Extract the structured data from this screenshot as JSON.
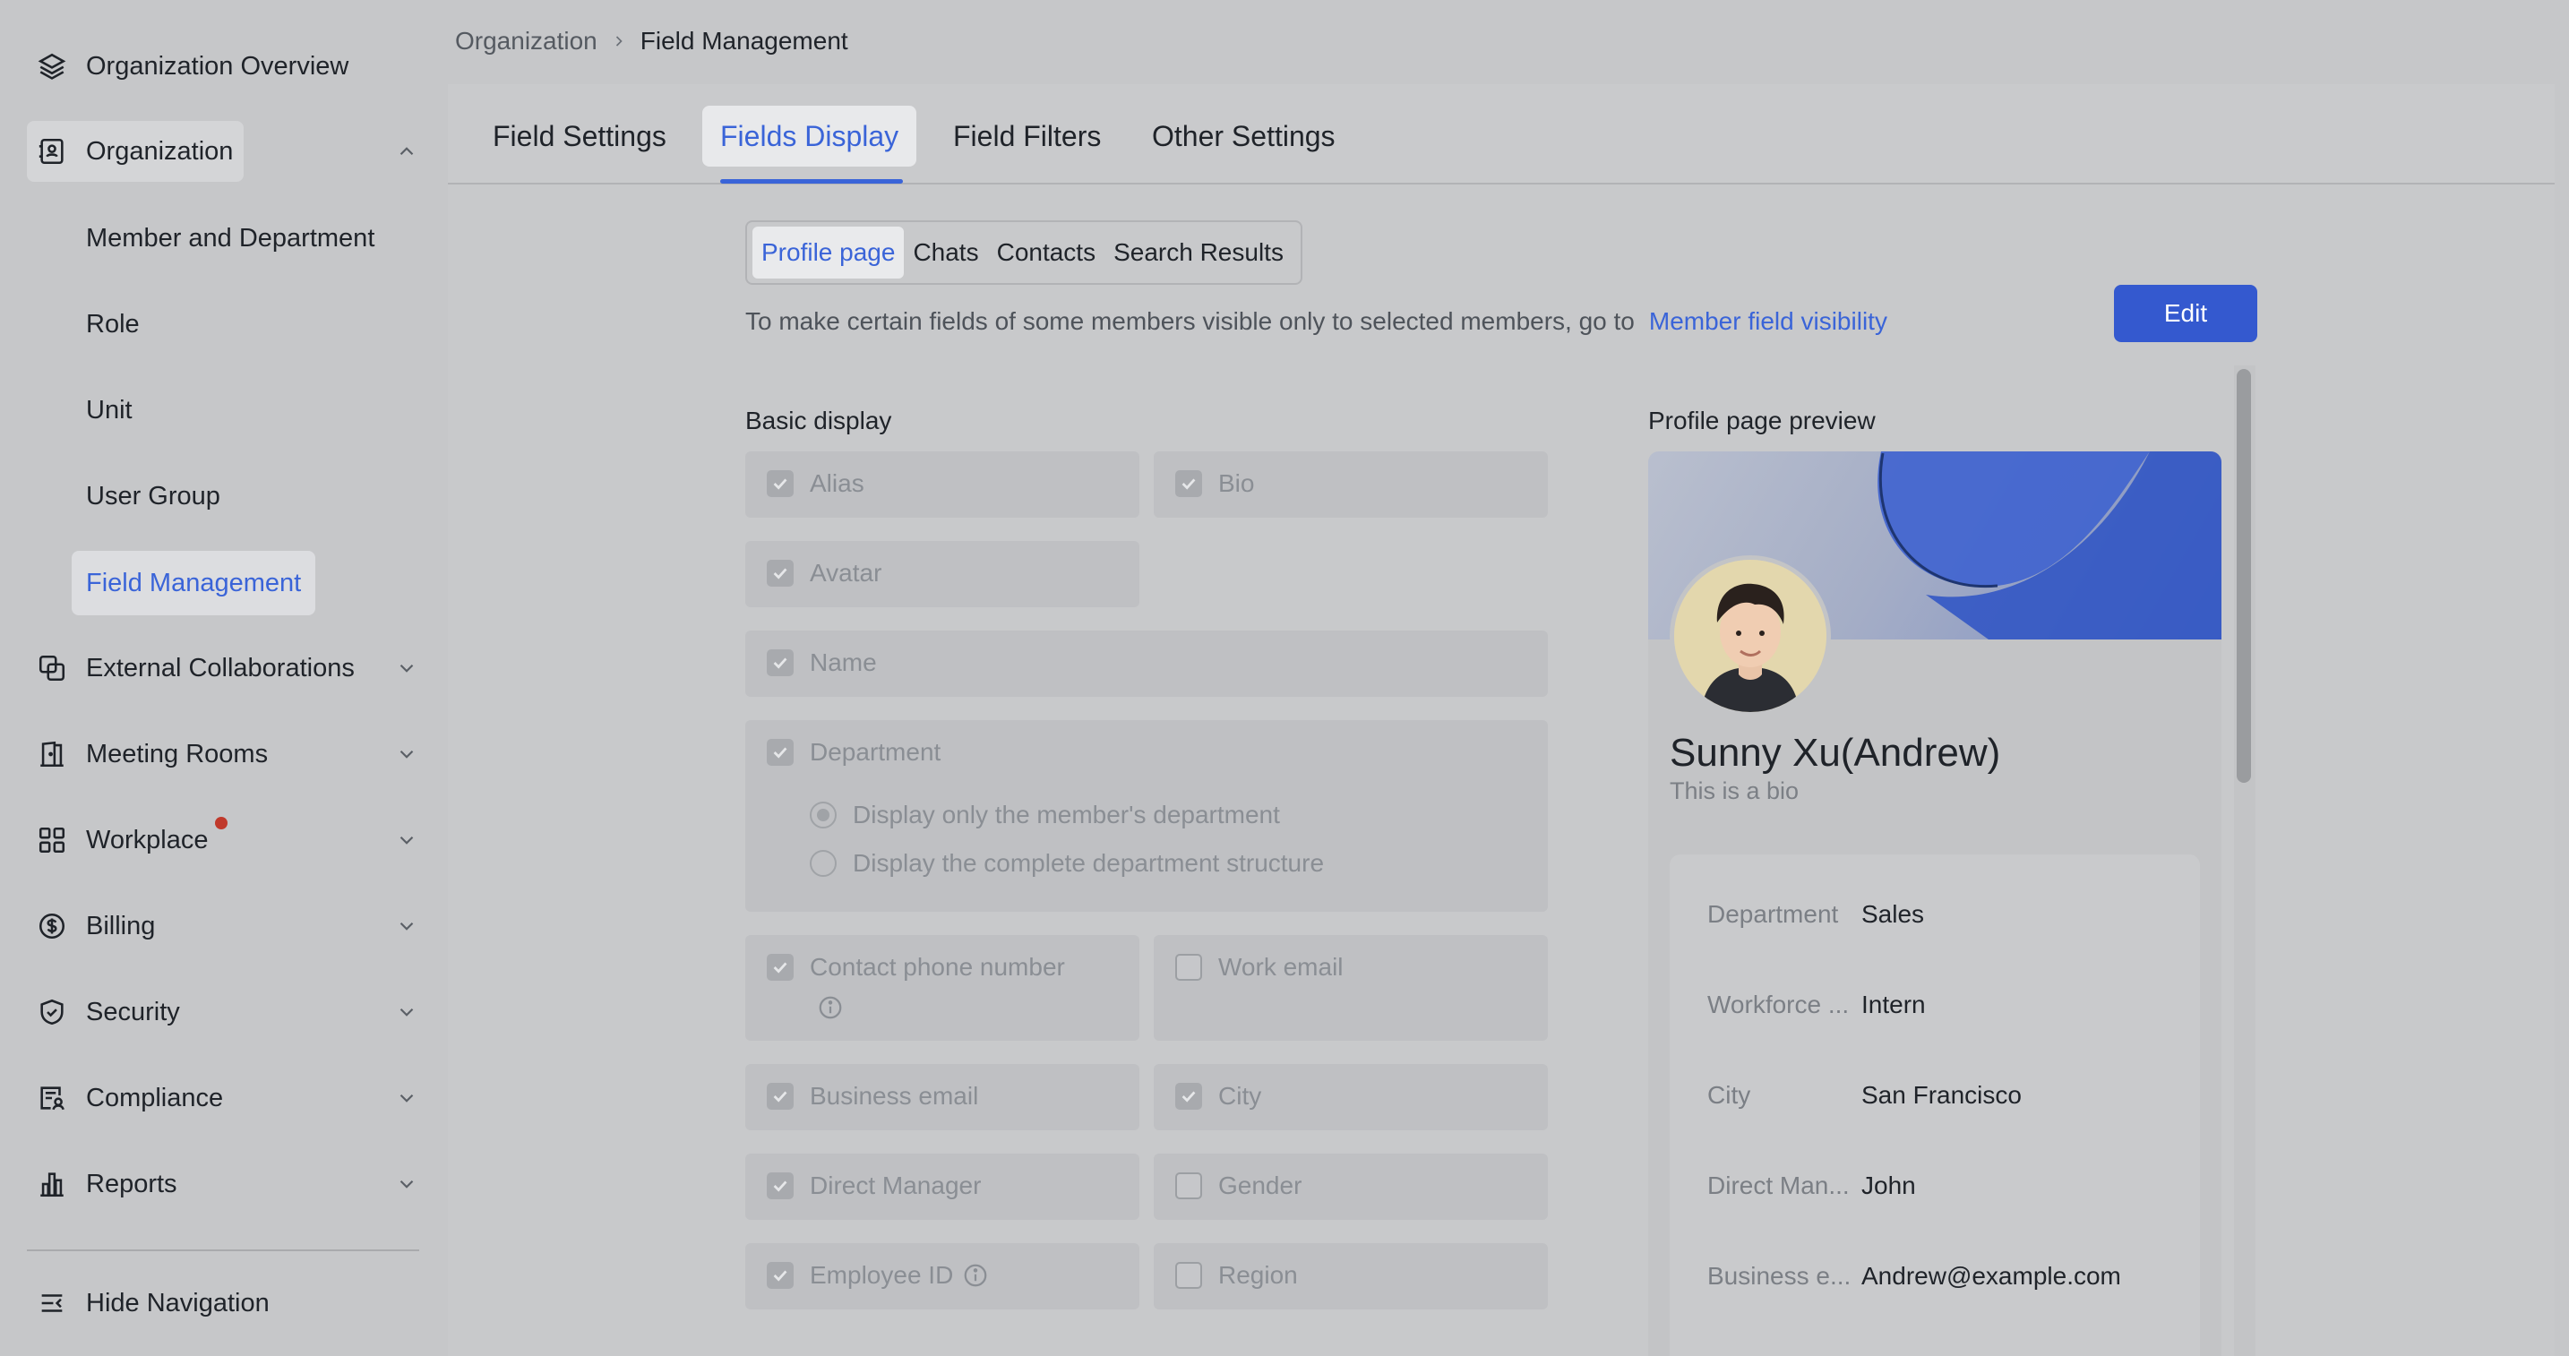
{
  "breadcrumb": {
    "parent": "Organization",
    "current": "Field Management"
  },
  "sidebar": {
    "overview": "Organization Overview",
    "organization": "Organization",
    "sub_items": [
      "Member and Department",
      "Role",
      "Unit",
      "User Group",
      "Field Management"
    ],
    "groups": [
      "External Collaborations",
      "Meeting Rooms",
      "Workplace",
      "Billing",
      "Security",
      "Compliance",
      "Reports"
    ],
    "hide_nav": "Hide Navigation"
  },
  "tabs": [
    "Field Settings",
    "Fields Display",
    "Field Filters",
    "Other Settings"
  ],
  "segments": [
    "Profile page",
    "Chats",
    "Contacts",
    "Search Results"
  ],
  "hint": {
    "text": "To make certain fields of some members visible only to selected members, go to",
    "link": "Member field visibility"
  },
  "edit_label": "Edit",
  "basic_display": {
    "title": "Basic display",
    "alias": "Alias",
    "bio": "Bio",
    "avatar": "Avatar",
    "name": "Name",
    "department": "Department",
    "dept_option_1": "Display only the member's department",
    "dept_option_2": "Display the complete department structure",
    "contact_phone": "Contact phone number",
    "work_email": "Work email",
    "business_email": "Business email",
    "city": "City",
    "direct_manager": "Direct Manager",
    "gender": "Gender",
    "employee_id": "Employee ID",
    "region": "Region"
  },
  "preview": {
    "title": "Profile page preview",
    "name": "Sunny Xu(Andrew)",
    "bio": "This is a bio",
    "rows": [
      {
        "key": "Department",
        "value": "Sales"
      },
      {
        "key": "Workforce ...",
        "value": "Intern"
      },
      {
        "key": "City",
        "value": "San Francisco"
      },
      {
        "key": "Direct Man...",
        "value": "John"
      },
      {
        "key": "Business e...",
        "value": "Andrew@example.com"
      }
    ]
  },
  "colors": {
    "accent": "#3a64d8",
    "button": "#3459cf",
    "notification_dot": "#c0392b"
  }
}
